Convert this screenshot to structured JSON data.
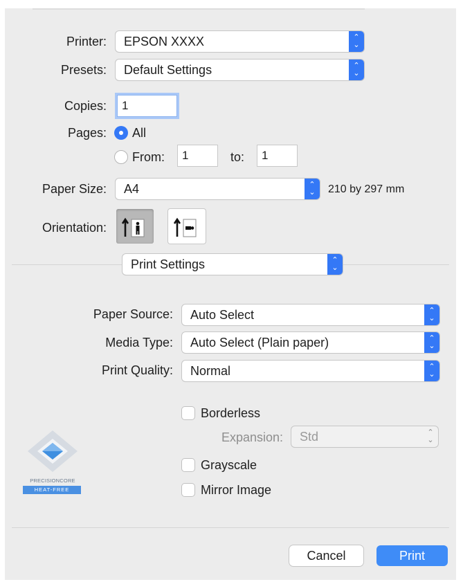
{
  "printer": {
    "label": "Printer:",
    "value": "EPSON XXXX"
  },
  "presets": {
    "label": "Presets:",
    "value": "Default Settings"
  },
  "copies": {
    "label": "Copies:",
    "value": "1"
  },
  "pages": {
    "label": "Pages:",
    "all_label": "All",
    "from_label": "From:",
    "from_value": "1",
    "to_label": "to:",
    "to_value": "1"
  },
  "paper_size": {
    "label": "Paper Size:",
    "value": "A4",
    "dimensions": "210 by 297 mm"
  },
  "orientation": {
    "label": "Orientation:",
    "selected": "portrait"
  },
  "section_popup": {
    "value": "Print Settings"
  },
  "paper_source": {
    "label": "Paper Source:",
    "value": "Auto Select"
  },
  "media_type": {
    "label": "Media Type:",
    "value": "Auto Select (Plain paper)"
  },
  "print_quality": {
    "label": "Print Quality:",
    "value": "Normal"
  },
  "borderless": {
    "label": "Borderless",
    "checked": false
  },
  "expansion": {
    "label": "Expansion:",
    "value": "Std",
    "enabled": false
  },
  "grayscale": {
    "label": "Grayscale",
    "checked": false
  },
  "mirror_image": {
    "label": "Mirror Image",
    "checked": false
  },
  "logo": {
    "line1": "PRECISIONCORE",
    "line2": "HEAT-FREE"
  },
  "buttons": {
    "cancel": "Cancel",
    "print": "Print"
  },
  "colors": {
    "accent": "#3478f6",
    "panel": "#ececec",
    "print_button": "#3f8cf7"
  },
  "icons": {
    "popup_arrow": "chevron-up-down-icon",
    "portrait": "portrait-orientation-icon",
    "landscape": "landscape-orientation-icon"
  }
}
